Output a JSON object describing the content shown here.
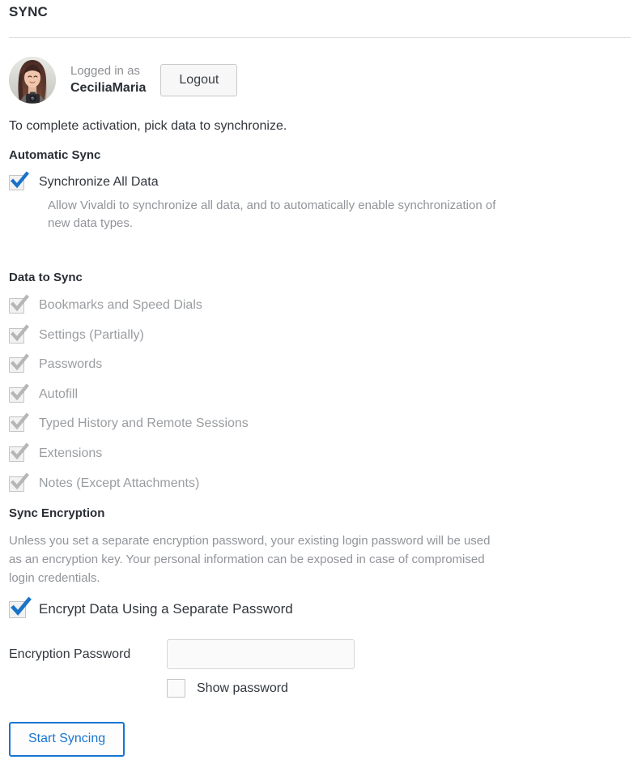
{
  "header": {
    "title": "SYNC"
  },
  "account": {
    "avatar_alt": "user-avatar",
    "logged_in_label": "Logged in as",
    "username": "CeciliaMaria",
    "logout_label": "Logout"
  },
  "intro": {
    "text": "To complete activation, pick data to synchronize."
  },
  "automatic_sync": {
    "heading": "Automatic Sync",
    "checkbox_label": "Synchronize All Data",
    "checked": true,
    "description": "Allow Vivaldi to synchronize all data, and to automatically enable synchronization of new data types."
  },
  "data_to_sync": {
    "heading": "Data to Sync",
    "items": [
      {
        "label": "Bookmarks and Speed Dials",
        "checked": true,
        "disabled": true
      },
      {
        "label": "Settings (Partially)",
        "checked": true,
        "disabled": true
      },
      {
        "label": "Passwords",
        "checked": true,
        "disabled": true
      },
      {
        "label": "Autofill",
        "checked": true,
        "disabled": true
      },
      {
        "label": "Typed History and Remote Sessions",
        "checked": true,
        "disabled": true
      },
      {
        "label": "Extensions",
        "checked": true,
        "disabled": true
      },
      {
        "label": "Notes (Except Attachments)",
        "checked": true,
        "disabled": true
      }
    ]
  },
  "sync_encryption": {
    "heading": "Sync Encryption",
    "description": "Unless you set a separate encryption password, your existing login password will be used as an encryption key. Your personal information can be exposed in case of compromised login credentials.",
    "encrypt_checkbox_label": "Encrypt Data Using a Separate Password",
    "encrypt_checked": true,
    "password_label": "Encryption Password",
    "password_value": "",
    "password_placeholder": "",
    "show_password_label": "Show password",
    "show_password_checked": false
  },
  "actions": {
    "start_syncing_label": "Start Syncing"
  },
  "colors": {
    "accent_blue": "#1675d1",
    "checkbox_blue": "#1a73c8",
    "text_dark": "#2a2e35",
    "text_muted": "#8d9094",
    "divider": "#dcdcdc"
  }
}
